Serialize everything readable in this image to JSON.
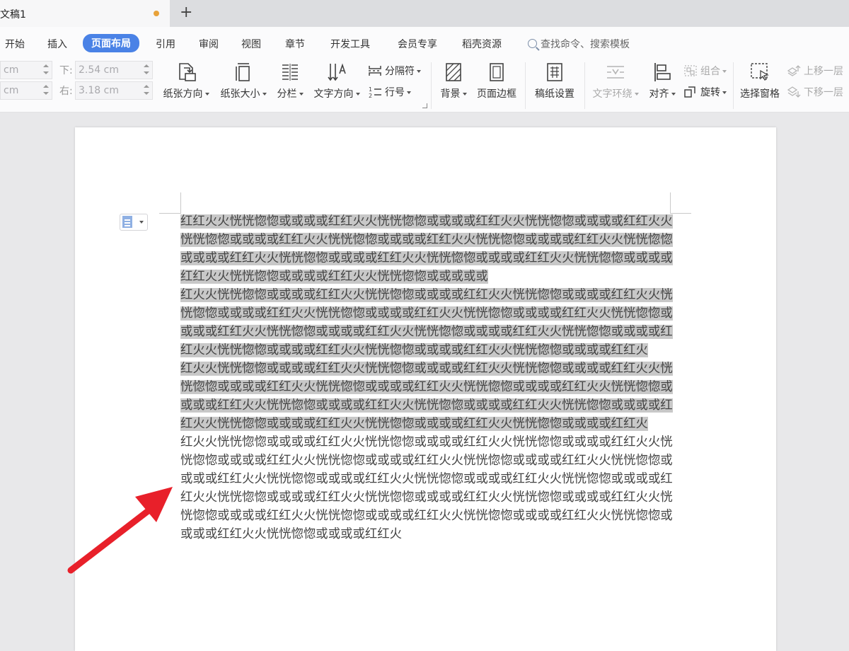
{
  "tab": {
    "title": "文稿1",
    "new_tab": "+"
  },
  "menu": {
    "items": [
      "开始",
      "插入",
      "页面布局",
      "引用",
      "审阅",
      "视图",
      "章节",
      "开发工具",
      "会员专享",
      "稻壳资源"
    ],
    "active": "页面布局",
    "search": "查找命令、搜索模板"
  },
  "margins": {
    "top_value": "cm",
    "left_value": "cm",
    "bottom_label": "下:",
    "bottom_value": "2.54 cm",
    "right_label": "右:",
    "right_value": "3.18 cm"
  },
  "tools": {
    "orientation": "纸张方向",
    "size": "纸张大小",
    "columns": "分栏",
    "text_direction": "文字方向",
    "breaks": "分隔符",
    "line_numbers": "行号",
    "background": "背景",
    "page_border": "页面边框",
    "paper_settings": "稿纸设置",
    "text_wrap": "文字环绕",
    "align": "对齐",
    "group": "组合",
    "rotate": "旋转",
    "selection_pane": "选择窗格",
    "bring_forward": "上移一层",
    "send_backward": "下移一层"
  },
  "document": {
    "paragraphs": [
      {
        "selected": true,
        "text": "红红火火恍恍惚惚或或或或红红火火恍恍惚惚或或或或红红火火恍恍惚惚或或或或红红火火恍恍惚惚或或或或红红火火恍恍惚惚或或或或红红火火恍恍惚惚或或或或红红火火恍恍惚惚或或或或红红火火恍恍惚惚或或或或红红火火恍恍惚惚或或或或红红火火恍恍惚惚或或或或红红火火恍恍惚惚或或或或红红火火恍恍惚惚或或或或或"
      },
      {
        "selected": true,
        "text": "红火火恍恍惚惚或或或或红红火火恍恍惚惚或或或或红红火火恍恍惚惚或或或或红红火火恍恍惚惚或或或或红红火火恍恍惚惚或或或或红红火火恍恍惚惚或或或或红红火火恍恍惚惚或或或或红红火火恍恍惚惚或或或或红红火火恍恍惚惚或或或或红红火火恍恍惚惚或或或或红红火火恍恍惚惚或或或或红红火火恍恍惚惚或或或或红红火火恍恍惚惚或或或或红红火"
      },
      {
        "selected": true,
        "text": "红火火恍恍惚惚或或或或红红火火恍恍惚惚或或或或红红火火恍恍惚惚或或或或红红火火恍恍惚惚或或或或红红火火恍恍惚惚或或或或红红火火恍恍惚惚或或或或红红火火恍恍惚惚或或或或红红火火恍恍惚惚或或或或红红火火恍恍惚惚或或或或红红火火恍恍惚惚或或或或红红火火恍恍惚惚或或或或红红火火恍恍惚惚或或或或红红火火恍恍惚惚或或或或红红火"
      },
      {
        "selected": false,
        "text": "红火火恍恍惚惚或或或或红红火火恍恍惚惚或或或或红红火火恍恍惚惚或或或或红红火火恍恍惚惚或或或或红红火火恍恍惚惚或或或或红红火火恍恍惚惚或或或或红红火火恍恍惚惚或或或或红红火火恍恍惚惚或或或或红红火火恍恍惚惚或或或或红红火火恍恍惚惚或或或或红红火火恍恍惚惚或或或或红红火火恍恍惚惚或或或或红红火火恍恍惚惚或或或或红红火火恍恍惚惚或或或或红红火火恍恍惚惚或或或或红红火火恍恍惚惚或或或或红红火火恍恍惚惚或或或或红红火火恍恍惚惚或或或或红红火"
      }
    ]
  },
  "colors": {
    "accent": "#4a82e6",
    "selection": "#c8c8c8",
    "arrow": "#e8202a",
    "unsaved_dot": "#e8a23a"
  }
}
